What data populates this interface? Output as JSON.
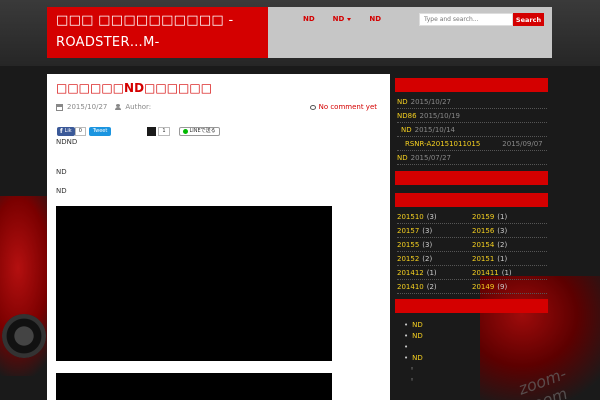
{
  "header": {
    "site_title": "□□□ □□□□□□□□□□ -ROADSTER…M-",
    "nav": [
      {
        "label": "ND",
        "dropdown": false
      },
      {
        "label": "ND",
        "dropdown": true
      },
      {
        "label": "ND",
        "dropdown": false
      }
    ],
    "search_placeholder": "Type and search...",
    "search_button": "Search"
  },
  "post": {
    "title": "□□□□□□ND□□□□□□",
    "date": "2015/10/27",
    "author_label": "Author:",
    "comments": "No comment yet",
    "share": {
      "fb_label": "Lik",
      "fb_count": "0",
      "tweet": "Tweet",
      "hatena_count": "1",
      "line": "LINEで送る"
    },
    "paragraphs": [
      "NDND",
      "ND",
      "ND"
    ]
  },
  "sidebar": {
    "recent_posts": [
      {
        "title": "ND",
        "date": "2015/10/27"
      },
      {
        "title": "ND86",
        "date": "2015/10/19"
      },
      {
        "title": "ND",
        "date": "2015/10/14"
      },
      {
        "title": "RSNR-A20151011015",
        "date": "2015/09/07"
      },
      {
        "title": "ND",
        "date": "2015/07/27"
      }
    ],
    "archives": [
      {
        "left": "201510",
        "left_count": "(3)",
        "right": "20159",
        "right_count": "(1)"
      },
      {
        "left": "20157",
        "left_count": "(3)",
        "right": "20156",
        "right_count": "(3)"
      },
      {
        "left": "20155",
        "left_count": "(3)",
        "right": "20154",
        "right_count": "(2)"
      },
      {
        "left": "20152",
        "left_count": "(2)",
        "right": "20151",
        "right_count": "(1)"
      },
      {
        "left": "201412",
        "left_count": "(1)",
        "right": "201411",
        "right_count": "(1)"
      },
      {
        "left": "201410",
        "left_count": "(2)",
        "right": "20149",
        "right_count": "(9)"
      }
    ],
    "categories": [
      {
        "label": "ND",
        "level": 0
      },
      {
        "label": "ND",
        "level": 0
      },
      {
        "label": "",
        "level": 0
      },
      {
        "label": "ND",
        "level": 0
      },
      {
        "label": "",
        "level": 1
      },
      {
        "label": "",
        "level": 1
      }
    ]
  },
  "colors": {
    "accent": "#d40000",
    "header_bg": "#c6c6c6",
    "link_yellow": "#f5d020"
  },
  "background": {
    "watermark": "zoom-zoom"
  }
}
